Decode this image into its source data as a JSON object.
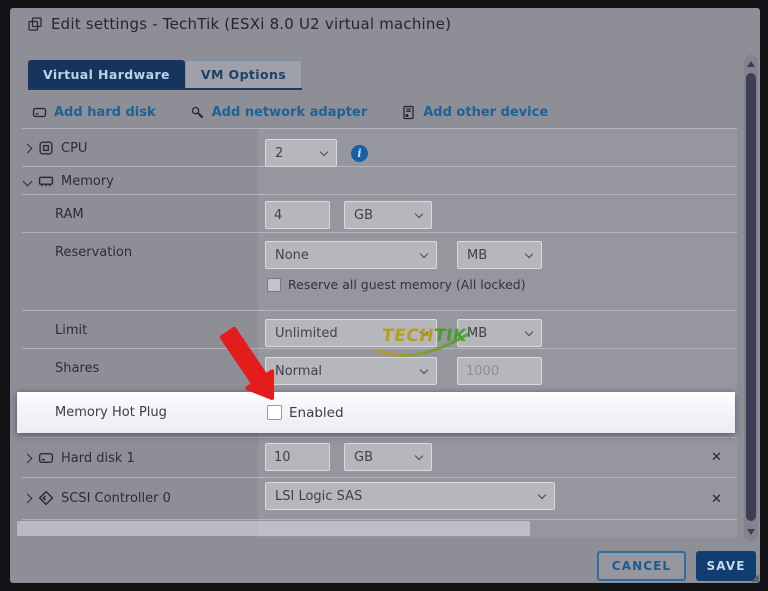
{
  "window": {
    "title": "Edit settings - TechTik (ESXi 8.0 U2 virtual machine)"
  },
  "tabs": {
    "virtual_hardware": "Virtual Hardware",
    "vm_options": "VM Options"
  },
  "toolbar": {
    "add_hard_disk": "Add hard disk",
    "add_network_adapter": "Add network adapter",
    "add_other_device": "Add other device"
  },
  "settings": {
    "cpu": {
      "label": "CPU",
      "value": "2"
    },
    "memory": {
      "label": "Memory"
    },
    "ram": {
      "label": "RAM",
      "value": "4",
      "unit": "GB"
    },
    "reservation": {
      "label": "Reservation",
      "value": "None",
      "unit": "MB",
      "checkbox_label": "Reserve all guest memory (All locked)",
      "checkbox_checked": false
    },
    "limit": {
      "label": "Limit",
      "value": "Unlimited",
      "unit": "MB"
    },
    "shares": {
      "label": "Shares",
      "value": "Normal",
      "amount": "1000"
    },
    "memory_hot_plug": {
      "label": "Memory Hot Plug",
      "checkbox_label": "Enabled",
      "checkbox_checked": false
    },
    "hard_disk_1": {
      "label": "Hard disk 1",
      "value": "10",
      "unit": "GB"
    },
    "scsi_controller_0": {
      "label": "SCSI Controller 0",
      "value": "LSI Logic SAS"
    }
  },
  "icons": {
    "info": "i",
    "remove": "✕"
  },
  "footer": {
    "cancel": "CANCEL",
    "save": "SAVE"
  },
  "watermark": {
    "text_left": "TECH",
    "text_right": "TIK"
  },
  "colors": {
    "tab_active_bg": "#16355e",
    "link_blue": "#1c6296",
    "info_blue": "#1a5ea6",
    "save_bg": "#113e70",
    "cancel_border": "#2e6da2",
    "arrow_red": "#e41c1c",
    "highlight_row_bg": "#f6f6fa",
    "watermark_yellow": "#b89c10",
    "watermark_green": "#3f9e25"
  }
}
